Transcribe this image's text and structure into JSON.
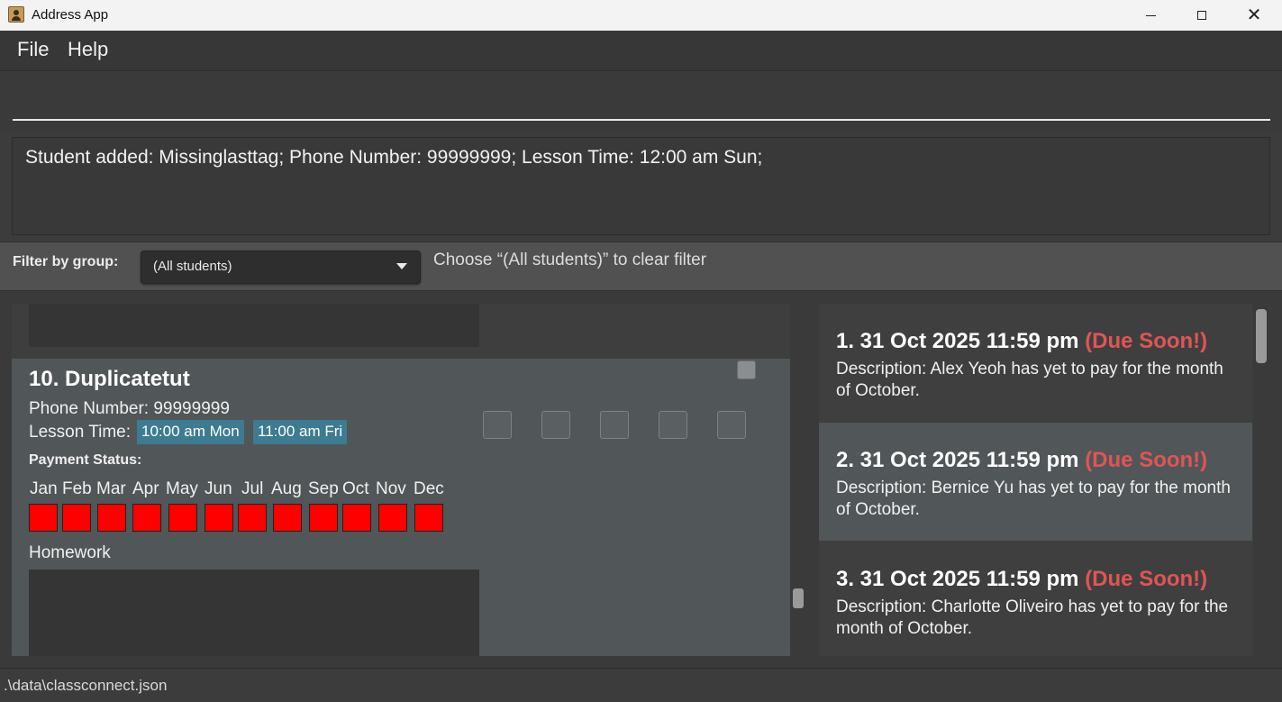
{
  "window": {
    "title": "Address App",
    "minimize_icon": "minimize-icon",
    "maximize_icon": "maximize-icon",
    "close_icon": "close-icon"
  },
  "menu": {
    "items": [
      "File",
      "Help"
    ]
  },
  "command": {
    "value": ""
  },
  "result": {
    "text": "Student added: Missinglasttag; Phone Number: 99999999; Lesson Time: 12:00 am Sun;"
  },
  "filter": {
    "label": "Filter by group:",
    "selected": "(All students)",
    "hint": "Choose “(All students)” to clear filter"
  },
  "student": {
    "name": "10. Duplicatetut",
    "phone": "Phone Number: 99999999",
    "lesson_label": "Lesson Time:",
    "lesson_tags": [
      "10:00 am Mon",
      "11:00 am Fri"
    ],
    "payment_label": "Payment Status:",
    "months": [
      "Jan",
      "Feb",
      "Mar",
      "Apr",
      "May",
      "Jun",
      "Jul",
      "Aug",
      "Sep",
      "Oct",
      "Nov",
      "Dec"
    ],
    "month_status_color": "#ff0000",
    "homework_label": "Homework",
    "homework_checkbox_count": 5
  },
  "reminders": [
    {
      "date": "1. 31 Oct 2025 11:59 pm",
      "flag": "(Due Soon!)",
      "desc": "Description: Alex Yeoh has yet to pay for the month of October."
    },
    {
      "date": "2. 31 Oct 2025 11:59 pm",
      "flag": "(Due Soon!)",
      "desc": "Description: Bernice Yu has yet to pay for the month of October."
    },
    {
      "date": "3. 31 Oct 2025 11:59 pm",
      "flag": "(Due Soon!)",
      "desc": "Description: Charlotte Oliveiro has yet to pay for the month of October."
    }
  ],
  "status": {
    "path": ".\\data\\classconnect.json"
  },
  "colors": {
    "accent_tag": "#3d7b92",
    "due_soon": "#e05555",
    "unpaid": "#ff0000"
  }
}
